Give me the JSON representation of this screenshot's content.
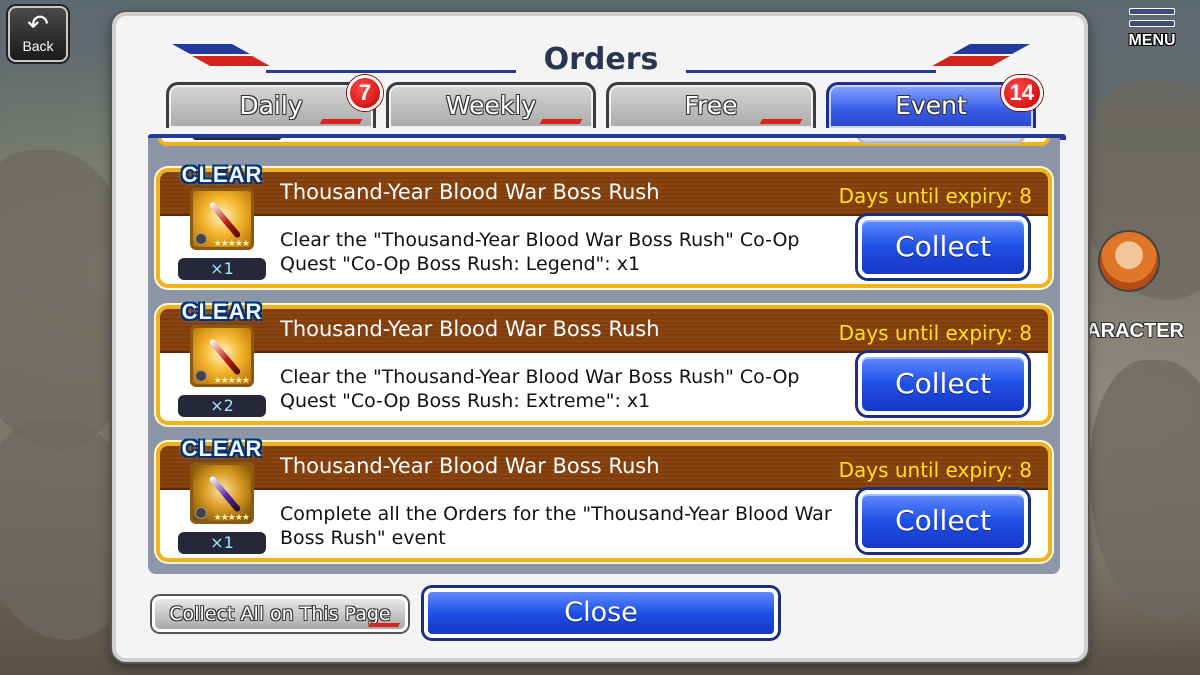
{
  "hud": {
    "back_label": "Back",
    "menu_label": "MENU",
    "character_label": "ARACTER"
  },
  "modal": {
    "title": "Orders",
    "tabs": [
      {
        "label": "Daily",
        "badge": "7",
        "active": false
      },
      {
        "label": "Weekly",
        "badge": "",
        "active": false
      },
      {
        "label": "Free",
        "badge": "",
        "active": false
      },
      {
        "label": "Event",
        "badge": "14",
        "active": true
      }
    ],
    "orders": [
      {
        "status": "CLEAR",
        "title": "Thousand-Year Blood War Boss Rush",
        "expiry": "Days until expiry: 8",
        "description": "Clear the \"Thousand-Year Blood War Boss Rush\" Co-Op Quest \"Co-Op Boss Rush: Legend\": x1",
        "reward_qty": "×1",
        "reward_icon": "red-brush-item-icon",
        "collect_label": "Collect"
      },
      {
        "status": "CLEAR",
        "title": "Thousand-Year Blood War Boss Rush",
        "expiry": "Days until expiry: 8",
        "description": "Clear the \"Thousand-Year Blood War Boss Rush\" Co-Op Quest \"Co-Op Boss Rush: Extreme\": x1",
        "reward_qty": "×2",
        "reward_icon": "red-brush-item-icon",
        "collect_label": "Collect"
      },
      {
        "status": "CLEAR",
        "title": "Thousand-Year Blood War Boss Rush",
        "expiry": "Days until expiry: 8",
        "description": "Complete all the Orders for the \"Thousand-Year Blood War Boss Rush\" event",
        "reward_qty": "×1",
        "reward_icon": "purple-brush-item-icon",
        "collect_label": "Collect"
      }
    ],
    "collect_all_label": "Collect All on This Page",
    "close_label": "Close"
  },
  "colors": {
    "accent_blue": "#1f4fe6",
    "card_border": "#f0b21e",
    "header_brown": "#7a3a0d",
    "expiry_yellow": "#ffe21a",
    "badge_red": "#c40000"
  }
}
